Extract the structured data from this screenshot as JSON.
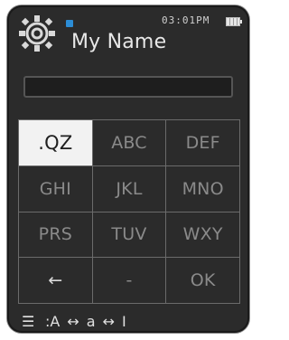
{
  "header": {
    "title": "My Name",
    "time": "03:01PM"
  },
  "icons": {
    "settings": "gear-icon",
    "indicator": "status-indicator-icon",
    "battery": "battery-icon",
    "menu": "menu-icon"
  },
  "input": {
    "value": ""
  },
  "keypad": {
    "keys": [
      ".QZ",
      "ABC",
      "DEF",
      "GHI",
      "JKL",
      "MNO",
      "PRS",
      "TUV",
      "WXY",
      "←",
      "-",
      "OK"
    ],
    "selected_index": 0
  },
  "footer": {
    "menu": "☰",
    "mode_prefix": ":A",
    "arrow1": "↔",
    "lower": "a",
    "arrow2": "↔",
    "cursor": "I"
  },
  "colors": {
    "screen": "#2b2b2b",
    "selected_key_bg": "#f2f2f2",
    "indicator": "#2c8dd6"
  }
}
